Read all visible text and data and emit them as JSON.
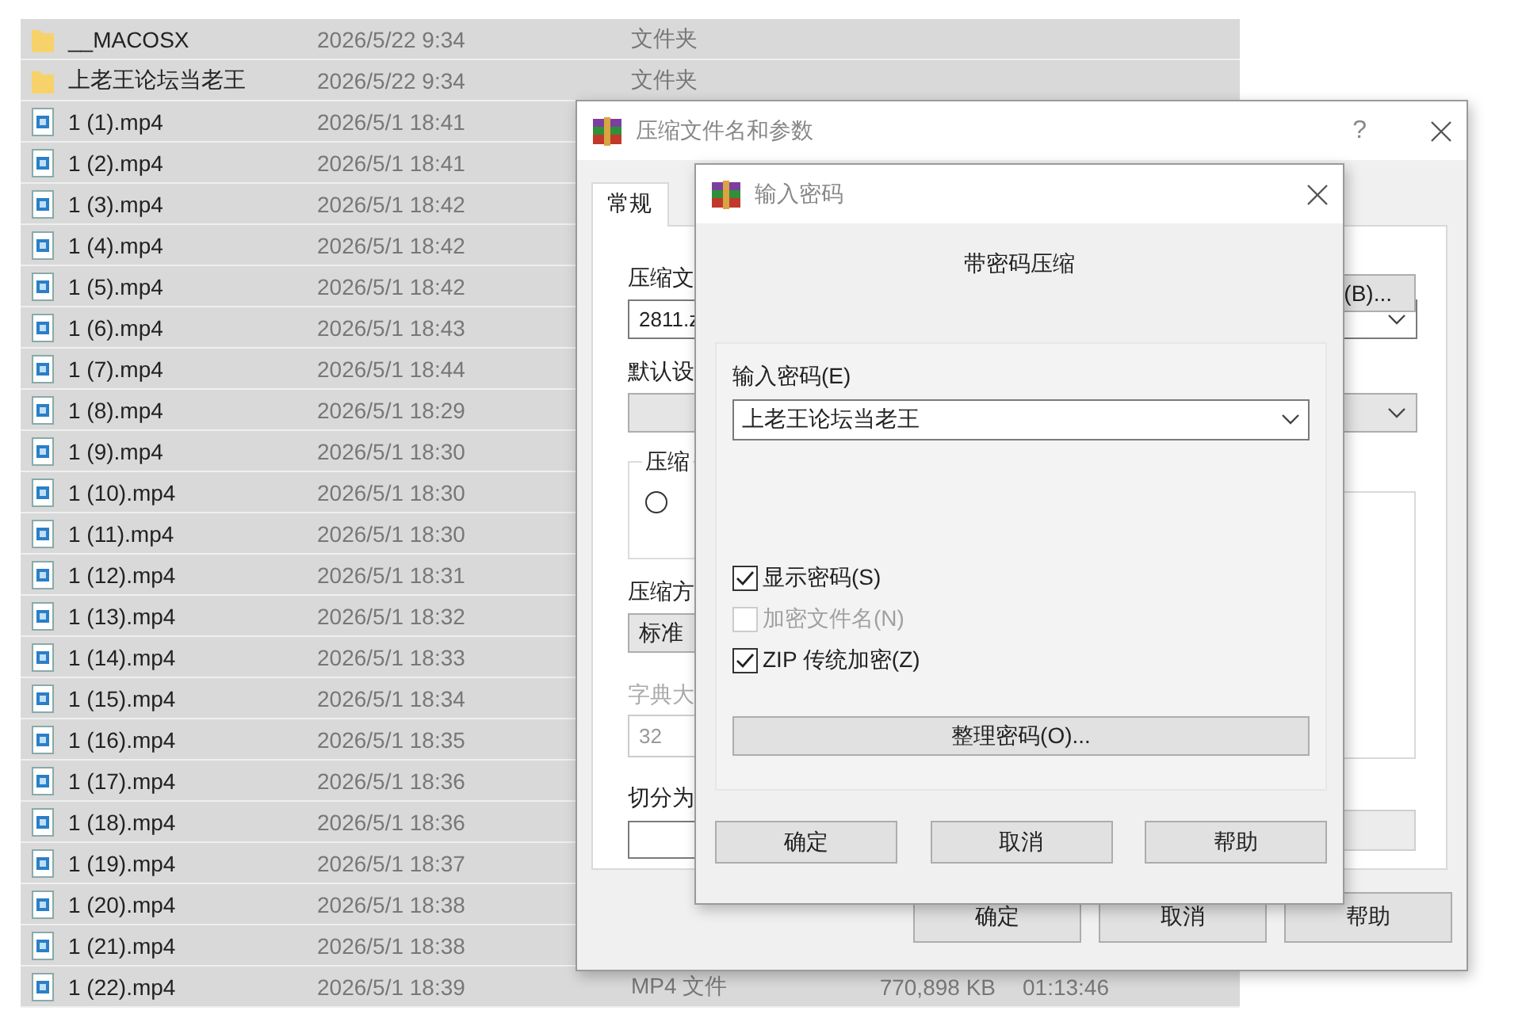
{
  "file_list": {
    "rows": [
      {
        "kind": "folder",
        "name": "__MACOSX",
        "modified": "2026/5/22 9:34",
        "type": "文件夹",
        "selected": true
      },
      {
        "kind": "folder",
        "name": "上老王论坛当老王",
        "modified": "2026/5/22 9:34",
        "type": "文件夹",
        "selected": true
      },
      {
        "kind": "video",
        "name": "1 (1).mp4",
        "modified": "2026/5/1 18:41",
        "selected": true
      },
      {
        "kind": "video",
        "name": "1 (2).mp4",
        "modified": "2026/5/1 18:41",
        "selected": true
      },
      {
        "kind": "video",
        "name": "1 (3).mp4",
        "modified": "2026/5/1 18:42",
        "selected": true
      },
      {
        "kind": "video",
        "name": "1 (4).mp4",
        "modified": "2026/5/1 18:42",
        "selected": true
      },
      {
        "kind": "video",
        "name": "1 (5).mp4",
        "modified": "2026/5/1 18:42",
        "selected": true
      },
      {
        "kind": "video",
        "name": "1 (6).mp4",
        "modified": "2026/5/1 18:43",
        "selected": true
      },
      {
        "kind": "video",
        "name": "1 (7).mp4",
        "modified": "2026/5/1 18:44",
        "selected": true
      },
      {
        "kind": "video",
        "name": "1 (8).mp4",
        "modified": "2026/5/1 18:29",
        "selected": true
      },
      {
        "kind": "video",
        "name": "1 (9).mp4",
        "modified": "2026/5/1 18:30",
        "selected": true
      },
      {
        "kind": "video",
        "name": "1 (10).mp4",
        "modified": "2026/5/1 18:30",
        "selected": true
      },
      {
        "kind": "video",
        "name": "1 (11).mp4",
        "modified": "2026/5/1 18:30",
        "selected": true
      },
      {
        "kind": "video",
        "name": "1 (12).mp4",
        "modified": "2026/5/1 18:31",
        "selected": true
      },
      {
        "kind": "video",
        "name": "1 (13).mp4",
        "modified": "2026/5/1 18:32",
        "selected": true
      },
      {
        "kind": "video",
        "name": "1 (14).mp4",
        "modified": "2026/5/1 18:33",
        "selected": true
      },
      {
        "kind": "video",
        "name": "1 (15).mp4",
        "modified": "2026/5/1 18:34",
        "selected": true
      },
      {
        "kind": "video",
        "name": "1 (16).mp4",
        "modified": "2026/5/1 18:35",
        "selected": true
      },
      {
        "kind": "video",
        "name": "1 (17).mp4",
        "modified": "2026/5/1 18:36",
        "selected": true
      },
      {
        "kind": "video",
        "name": "1 (18).mp4",
        "modified": "2026/5/1 18:36",
        "selected": true
      },
      {
        "kind": "video",
        "name": "1 (19).mp4",
        "modified": "2026/5/1 18:37",
        "selected": true
      },
      {
        "kind": "video",
        "name": "1 (20).mp4",
        "modified": "2026/5/1 18:38",
        "selected": true
      },
      {
        "kind": "video",
        "name": "1 (21).mp4",
        "modified": "2026/5/1 18:38",
        "selected": true
      },
      {
        "kind": "video",
        "name": "1 (22).mp4",
        "modified": "2026/5/1 18:39",
        "type": "MP4 文件",
        "size": "770,898 KB",
        "duration": "01:13:46",
        "selected": true
      }
    ]
  },
  "archive_dialog": {
    "title": "压缩文件名和参数",
    "help": "?",
    "tabs": [
      {
        "label": "常规",
        "selected": true
      }
    ],
    "archive_name_label": "压缩文",
    "browse_button": "(B)...",
    "archive_name_value": "2811.z",
    "profile_label": "默认设",
    "format_group_label": "压缩",
    "format_radio": {
      "selected": false
    },
    "method_label": "压缩方",
    "method_value": "标准",
    "dictionary_label": "字典大",
    "dictionary_value": "32",
    "dictionary_disabled": true,
    "split_label": "切分为",
    "buttons": [
      "确定",
      "取消",
      "帮助"
    ]
  },
  "password_dialog": {
    "title": "输入密码",
    "heading": "带密码压缩",
    "password_label": "输入密码(E)",
    "password_value": "上老王论坛当老王",
    "options": [
      {
        "label": "显示密码(S)",
        "checked": true,
        "disabled": false
      },
      {
        "label": "加密文件名(N)",
        "checked": false,
        "disabled": true
      },
      {
        "label": "ZIP 传统加密(Z)",
        "checked": true,
        "disabled": false
      }
    ],
    "organize_button": "整理密码(O)...",
    "buttons": [
      "确定",
      "取消",
      "帮助"
    ]
  }
}
